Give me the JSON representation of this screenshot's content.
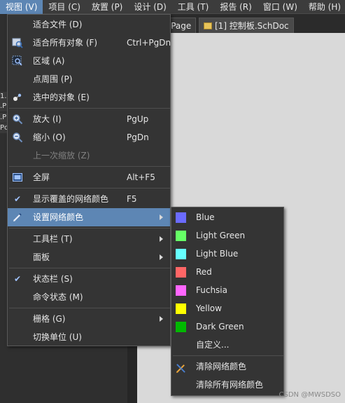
{
  "menubar": [
    {
      "label": "视图 (V)",
      "active": true
    },
    {
      "label": "项目 (C)"
    },
    {
      "label": "放置 (P)"
    },
    {
      "label": "设计 (D)"
    },
    {
      "label": "工具 (T)"
    },
    {
      "label": "报告 (R)"
    },
    {
      "label": "窗口 (W)"
    },
    {
      "label": "帮助 (H)"
    }
  ],
  "tabs": [
    {
      "label": "e Page"
    },
    {
      "label": "[1] 控制板.SchDoc"
    }
  ],
  "left_panel_fragments": [
    "1.",
    ".P",
    ".P",
    "Pc"
  ],
  "view_menu": [
    {
      "label": "适合文件 (D)",
      "shortcut": "",
      "icon": "fit-document-icon"
    },
    {
      "label": "适合所有对象 (F)",
      "shortcut": "Ctrl+PgDn",
      "icon": "fit-all-objects-icon"
    },
    {
      "label": "区域 (A)",
      "shortcut": "",
      "icon": "area-zoom-icon"
    },
    {
      "label": "点周围 (P)",
      "shortcut": "",
      "icon": ""
    },
    {
      "label": "选中的对象 (E)",
      "shortcut": "",
      "icon": "selected-objects-icon"
    },
    {
      "label": "放大 (I)",
      "shortcut": "PgUp",
      "icon": "zoom-in-icon"
    },
    {
      "label": "缩小 (O)",
      "shortcut": "PgDn",
      "icon": "zoom-out-icon"
    },
    {
      "label": "上一次缩放 (Z)",
      "shortcut": "",
      "icon": "",
      "disabled": true
    },
    {
      "label": "全屏",
      "shortcut": "Alt+F5",
      "icon": "fullscreen-icon"
    },
    {
      "label": "显示覆盖的网络颜色",
      "shortcut": "F5",
      "icon": "check-icon"
    },
    {
      "label": "设置网络颜色",
      "shortcut": "",
      "icon": "pen-icon",
      "submenu": true,
      "highlight": true
    },
    {
      "label": "工具栏 (T)",
      "shortcut": "",
      "submenu": true
    },
    {
      "label": "面板",
      "shortcut": "",
      "submenu": true
    },
    {
      "label": "状态栏 (S)",
      "shortcut": "",
      "icon": "check-icon"
    },
    {
      "label": "命令状态 (M)",
      "shortcut": ""
    },
    {
      "label": "栅格 (G)",
      "shortcut": "",
      "submenu": true
    },
    {
      "label": "切换单位 (U)",
      "shortcut": ""
    }
  ],
  "net_color_submenu": [
    {
      "label": "Blue",
      "color": "#6b6bff"
    },
    {
      "label": "Light Green",
      "color": "#66ff66"
    },
    {
      "label": "Light Blue",
      "color": "#66ffff"
    },
    {
      "label": "Red",
      "color": "#ff6666"
    },
    {
      "label": "Fuchsia",
      "color": "#ff66ff"
    },
    {
      "label": "Yellow",
      "color": "#ffff00"
    },
    {
      "label": "Dark Green",
      "color": "#00b800"
    },
    {
      "label": "自定义...",
      "color": ""
    },
    {
      "label": "清除网络颜色",
      "color": "",
      "icon": "clear-net-color-icon"
    },
    {
      "label": "清除所有网络颜色",
      "color": ""
    }
  ],
  "watermark": "CSDN @MWSDSO"
}
